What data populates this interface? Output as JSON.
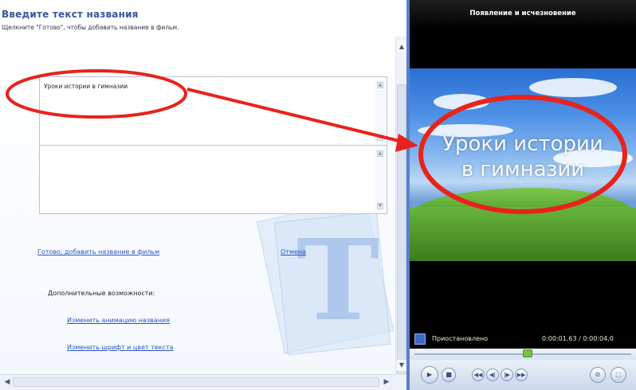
{
  "header": {
    "title": "Введите текст названия",
    "subtitle": "Щелкните \"Готово\", чтобы добавить название в фильм."
  },
  "editor": {
    "title_line1": "Уроки истории в гимназии",
    "title_line2": ""
  },
  "actions": {
    "done_link": "Готово, добавить название в фильм",
    "cancel_link": "Отмена",
    "more_options_label": "Дополнительные возможности:",
    "change_animation_link": "Изменить анимацию названия",
    "change_font_link": "Изменить шрифт и цвет текста"
  },
  "preview": {
    "title": "Появление и исчезновение",
    "overlay_line1": "Уроки истории",
    "overlay_line2": "в гимназии",
    "status": "Приостановлено",
    "time": "0:00:01,63 / 0:00:04,0"
  },
  "icons": {
    "scroll_up": "▲",
    "scroll_down": "▼",
    "scroll_left": "◀",
    "scroll_right": "▶",
    "play": "▶",
    "stop": "■",
    "rewind": "◀◀",
    "prev_frame": "◀|",
    "next_frame": "|▶",
    "forward": "▶▶",
    "split": "⊘",
    "snapshot": "⬚"
  },
  "colors": {
    "accent_blue": "#2a56c6",
    "annotation_red": "#e8231b",
    "panel_blue": "#1f3d8c"
  }
}
